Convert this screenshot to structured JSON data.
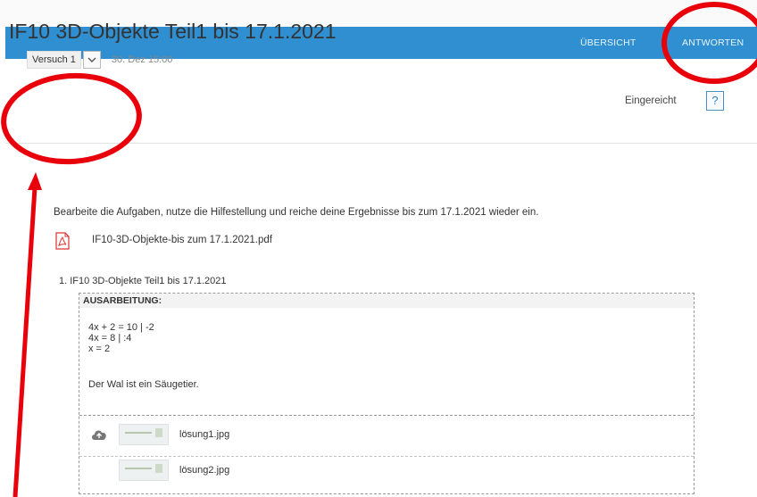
{
  "nav": {
    "overview": "ÜBERSICHT",
    "answers": "ANTWORTEN"
  },
  "assignment": {
    "title": "IF10 3D-Objekte Teil1 bis 17.1.2021",
    "attempt_label": "Versuch 1",
    "attempt_date": "30. Dez 15:00",
    "status": "Eingereicht",
    "help_label": "?"
  },
  "content": {
    "instruction": "Bearbeite die Aufgaben, nutze die Hilfestellung und reiche deine Ergebnisse bis zum 17.1.2021 wieder ein.",
    "attachment_name": "IF10-3D-Objekte-bis zum 17.1.2021.pdf",
    "question_label": "1.  IF10 3D-Objekte Teil1 bis 17.1.2021"
  },
  "answer": {
    "heading": "AUSARBEITUNG:",
    "line1": "4x + 2 = 10 | -2",
    "line2": "4x = 8 | :4",
    "line3": "x = 2",
    "sentence": "Der Wal ist ein Säugetier."
  },
  "files": [
    {
      "name": "lösung1.jpg",
      "icon": "cloud-upload-icon"
    },
    {
      "name": "lösung2.jpg"
    }
  ],
  "colors": {
    "nav_bar": "#2f8fd1",
    "annotation": "#e8000b"
  }
}
